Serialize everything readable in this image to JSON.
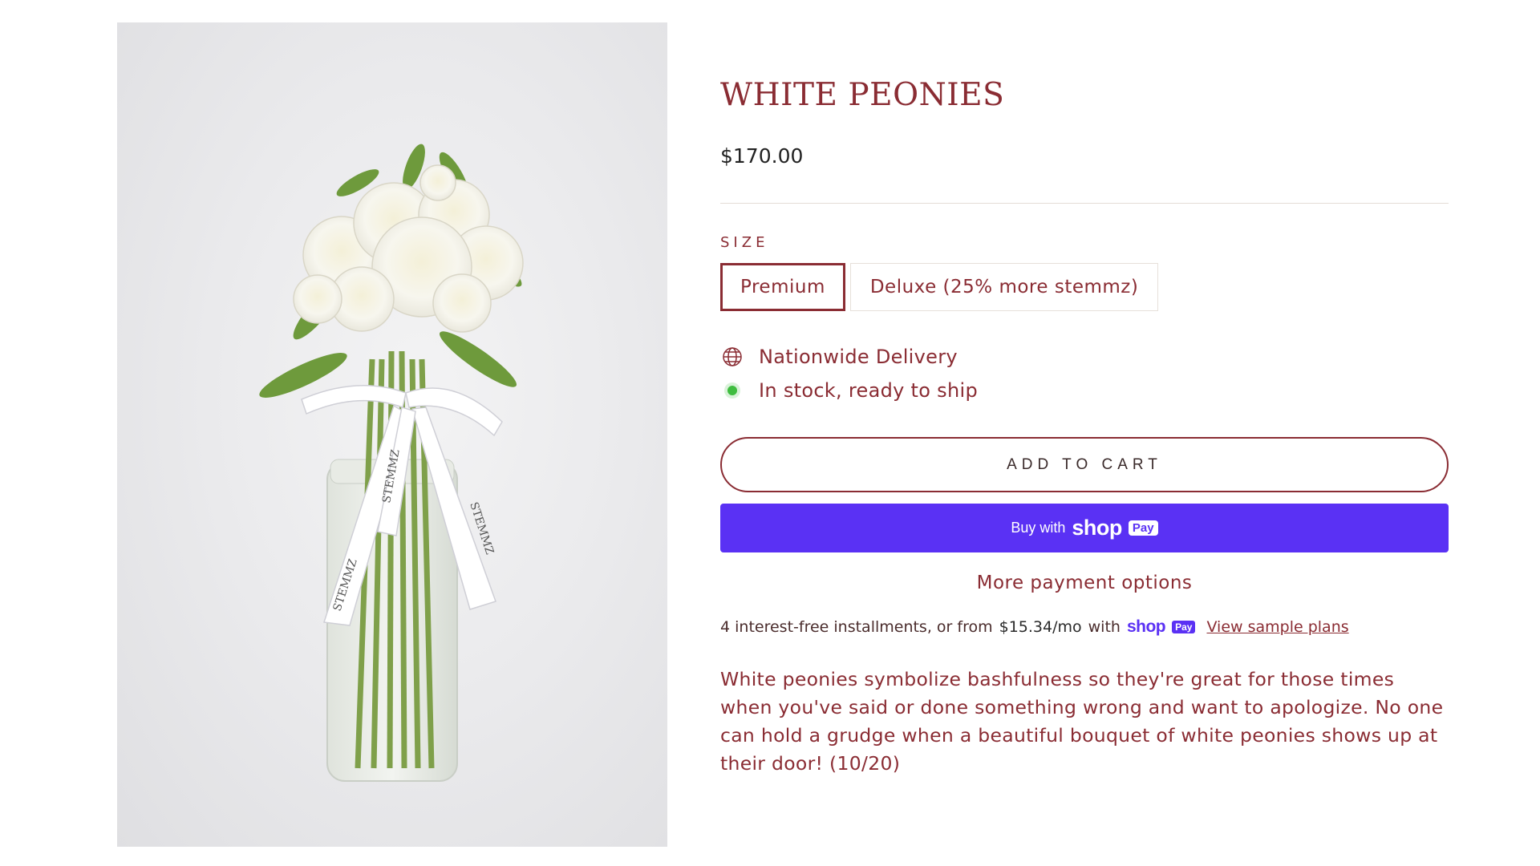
{
  "product": {
    "title": "WHITE PEONIES",
    "price": "$170.00",
    "image_ribbon_text": "STEMMZ"
  },
  "size": {
    "label": "SIZE",
    "options": [
      {
        "label": "Premium",
        "selected": true
      },
      {
        "label": "Deluxe (25% more stemmz)",
        "selected": false
      }
    ]
  },
  "features": {
    "delivery": {
      "icon": "globe-icon",
      "text": "Nationwide Delivery"
    },
    "stock": {
      "icon": "green-dot-icon",
      "text": "In stock, ready to ship"
    }
  },
  "buttons": {
    "add_to_cart": "ADD TO CART",
    "shop_pay": {
      "prefix": "Buy with",
      "brand": "shop",
      "badge": "Pay"
    },
    "more_payment": "More payment options"
  },
  "installments": {
    "text": "4 interest-free installments, or from",
    "price": "$15.34/mo",
    "with": "with",
    "brand": "shop",
    "badge": "Pay",
    "link": "View sample plans"
  },
  "description": "White peonies symbolize bashfulness so they're great for those times when you've said or done something wrong and want to apologize. No one can hold a grudge when a beautiful bouquet of white peonies shows up at their door!  (10/20)",
  "colors": {
    "brand": "#8a2c33",
    "shop_pay": "#5a31f4",
    "in_stock": "#3fbd40"
  }
}
